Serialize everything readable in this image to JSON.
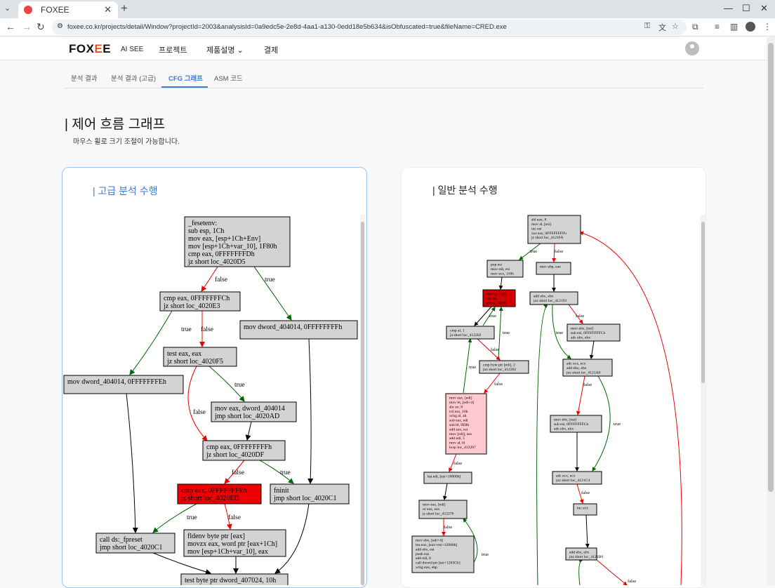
{
  "browser": {
    "tab_title": "FOXEE",
    "url": "foxee.co.kr/projects/detail/Window?projectId=2003&analysisId=0a9edc5e-2e8d-4aa1-a130-0edd18e5b634&isObfuscated=true&fileName=CRED.exe"
  },
  "site": {
    "logo_left": "FOX",
    "logo_accent": "E",
    "logo_right": "E",
    "logo_sub": "AI SEE",
    "nav": [
      "프로젝트",
      "제품설명",
      "결제"
    ],
    "nav_chevron": "chevron-down-icon"
  },
  "subtabs": [
    "분석 결과",
    "분석 결과 (고급)",
    "CFG 그래프",
    "ASM 코드"
  ],
  "active_subtab": "CFG 그래프",
  "accent_color": "#3a7bd5",
  "page": {
    "title": "| 제어 흐름 그래프",
    "description": "마우스 휠로 크기 조절이 가능합니다."
  },
  "advanced": {
    "title": "| 고급 분석 수행",
    "nodes": {
      "n1": [
        "_fesetenv:",
        "sub     esp, 1Ch",
        "mov     eax, [esp+1Ch+Env]",
        "mov     [esp+1Ch+var_10], 1F80h",
        "cmp     eax, 0FFFFFFFDh",
        "jz      short loc_4020D5"
      ],
      "n2": [
        "cmp     eax, 0FFFFFFFCh",
        "jz      short loc_4020E3"
      ],
      "n3": [
        "mov     dword_404014, 0FFFFFFFFh"
      ],
      "n4": [
        "test    eax, eax",
        "jz      short loc_4020F5"
      ],
      "n5": [
        "mov     dword_404014, 0FFFFFFFEh"
      ],
      "n6": [
        "mov     eax, dword_404014",
        "jmp     short loc_4020AD"
      ],
      "n7": [
        "cmp     eax, 0FFFFFFFFh",
        "jz      short loc_4020DF"
      ],
      "n8": [
        "cmp     eax, 0FFFFFFFEh",
        "jz      short loc_4020ED"
      ],
      "n9": [
        "fninit",
        "jmp     short loc_4020C1"
      ],
      "n10": [
        "call    ds:_fpreset",
        "jmp     short loc_4020C1"
      ],
      "n11": [
        "fldenv  byte ptr [eax]",
        "movzx   eax, word ptr [eax+1Ch]",
        "mov     [esp+1Ch+var_10], eax"
      ],
      "n12": [
        "test    byte ptr dword_407024, 10h"
      ]
    },
    "edge_labels": {
      "t": "true",
      "f": "false"
    }
  },
  "normal": {
    "title": "| 일반 분석 수행",
    "nodes": {
      "m1": [
        "shl    eax, 8",
        "mov    al, [esi]",
        "inc    esi",
        "xor    eax, 0FFFFFFFFh",
        "jz     short loc_4121FA"
      ],
      "m2": [
        "pop    esi",
        "mov    edi, esi",
        "mov    ecx, 116h"
      ],
      "m3": [
        "mov    ebp, eax"
      ],
      "m4": [
        "mov    al, [edi]",
        "inc    edi",
        "sub    al, 0E8h"
      ],
      "m5": [
        "add    ebx, ebx",
        "jnz    short loc_412193"
      ],
      "m6": [
        "mov    ebx, [esi]",
        "sub    esi, 0FFFFFFFCh",
        "adc    ebx, ebx"
      ],
      "m7": [
        "cmp    al, 1",
        "ja     short loc_412202"
      ],
      "m8": [
        "cmp    byte ptr [edi], 2",
        "jnz    short loc_412202"
      ],
      "m9": [
        "adc    ecx, ecx",
        "add    ebx, ebx",
        "jnz    short loc_4121A0"
      ],
      "m10": [
        "mov    eax, [edi]",
        "mov    bl, [edi+4]",
        "shr    ax, 8",
        "rol    eax, 10h",
        "xchg   al, ah",
        "sub    eax, edi",
        "sub    bl, 0E8h",
        "add    eax, esi",
        "mov    [edi], eax",
        "add    edi, 5",
        "mov    al, bl",
        "loop   loc_412207"
      ],
      "m11": [
        "mov    ebx, [esi]",
        "sub    esi, 0FFFFFFFCh",
        "adc    ebx, ebx"
      ],
      "m12": [
        "lea    edi, [esi+10000h]"
      ],
      "m13": [
        "adc    ecx, ecx",
        "jnz    short loc_4121C4"
      ],
      "m14": [
        "mov    eax, [edi]",
        "or     eax, eax",
        "jz     short loc_412276"
      ],
      "m15": [
        "inc    ecx"
      ],
      "m16": [
        "mov    ebx, [edi+4]",
        "lea    eax, [eax+esi+12000h]",
        "add    ebx, esi",
        "push   eax",
        "add    edi, 8",
        "call   dword ptr [esi+1203Ch]",
        "xchg   eax, ebp"
      ],
      "m17": [
        "add    ebx, ebx",
        "jnz    short loc_4121B0"
      ]
    },
    "edge_labels": {
      "t": "true",
      "f": "false"
    }
  }
}
